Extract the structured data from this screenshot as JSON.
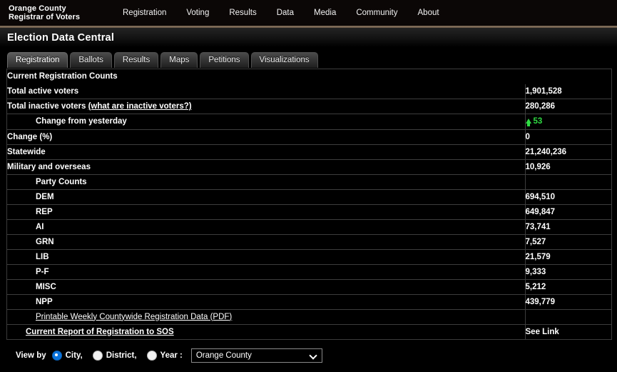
{
  "site": {
    "brand_line1": "Orange County",
    "brand_line2": "Registrar of Voters",
    "nav": [
      {
        "label": "Registration"
      },
      {
        "label": "Voting"
      },
      {
        "label": "Results"
      },
      {
        "label": "Data"
      },
      {
        "label": "Media"
      },
      {
        "label": "Community"
      },
      {
        "label": "About"
      }
    ]
  },
  "page": {
    "title": "Election Data Central"
  },
  "tabs": [
    {
      "label": "Registration",
      "active": true
    },
    {
      "label": "Ballots",
      "active": false
    },
    {
      "label": "Results",
      "active": false
    },
    {
      "label": "Maps",
      "active": false
    },
    {
      "label": "Petitions",
      "active": false
    },
    {
      "label": "Visualizations",
      "active": false
    }
  ],
  "table": {
    "section_header": "Current Registration Counts",
    "rows": [
      {
        "label": "Total active voters",
        "value": "1,901,528"
      },
      {
        "label": "Total inactive voters",
        "link_suffix": "(what are inactive voters?)",
        "value": "280,286"
      },
      {
        "label": "Change from yesterday",
        "value": "53",
        "delta": "up",
        "delta_color": "#2fdb43"
      },
      {
        "label": "Change (%)",
        "value": "0"
      },
      {
        "label": "Statewide",
        "value": "21,240,236"
      },
      {
        "label": "Military and overseas",
        "value": "10,926"
      },
      {
        "label": "Party Counts",
        "value": ""
      },
      {
        "label": "DEM",
        "value": "694,510"
      },
      {
        "label": "REP",
        "value": "649,847"
      },
      {
        "label": "AI",
        "value": "73,741"
      },
      {
        "label": "GRN",
        "value": "7,527"
      },
      {
        "label": "LIB",
        "value": "21,579"
      },
      {
        "label": "P-F",
        "value": "9,333"
      },
      {
        "label": "MISC",
        "value": "5,212"
      },
      {
        "label": "NPP",
        "value": "439,779"
      }
    ],
    "link_rows": [
      {
        "label": "Printable Weekly Countywide Registration Data (PDF)",
        "value": ""
      },
      {
        "label": "Current Report of Registration to SOS",
        "value": "See Link"
      }
    ]
  },
  "controls": {
    "view_by_label": "View by",
    "options": [
      {
        "label": "City,",
        "selected": true
      },
      {
        "label": "District,",
        "selected": false
      },
      {
        "label": "Year :",
        "selected": false
      }
    ],
    "select_value": "Orange County"
  }
}
